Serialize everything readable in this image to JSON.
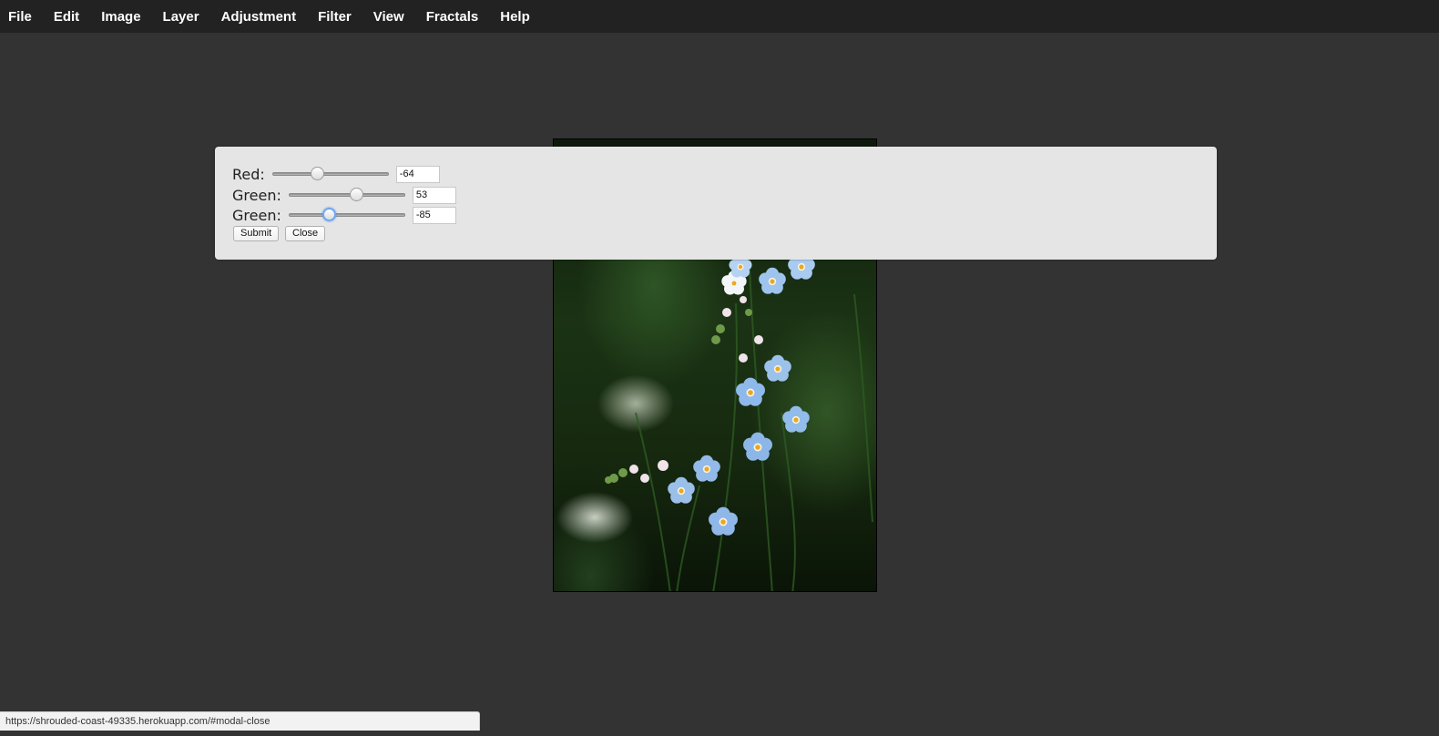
{
  "menu": {
    "items": [
      {
        "label": "File"
      },
      {
        "label": "Edit"
      },
      {
        "label": "Image"
      },
      {
        "label": "Layer"
      },
      {
        "label": "Adjustment"
      },
      {
        "label": "Filter"
      },
      {
        "label": "View"
      },
      {
        "label": "Fractals"
      },
      {
        "label": "Help"
      }
    ]
  },
  "canvas": {
    "image_subject": "blue forget-me-not flowers"
  },
  "modal": {
    "rows": [
      {
        "label": "Red:",
        "value": "-64",
        "level": -64,
        "min": -255,
        "max": 255
      },
      {
        "label": "Green:",
        "value": "53",
        "level": 53,
        "min": -255,
        "max": 255
      },
      {
        "label": "Green:",
        "value": "-85",
        "level": -85,
        "min": -255,
        "max": 255
      }
    ],
    "submit_label": "Submit",
    "close_label": "Close"
  },
  "status": {
    "url": "https://shrouded-coast-49335.herokuapp.com/#modal-close"
  },
  "colors": {
    "menubar": "#222222",
    "background": "#333333",
    "modal": "#e5e5e5",
    "focus_ring": "#6fa6f0"
  }
}
